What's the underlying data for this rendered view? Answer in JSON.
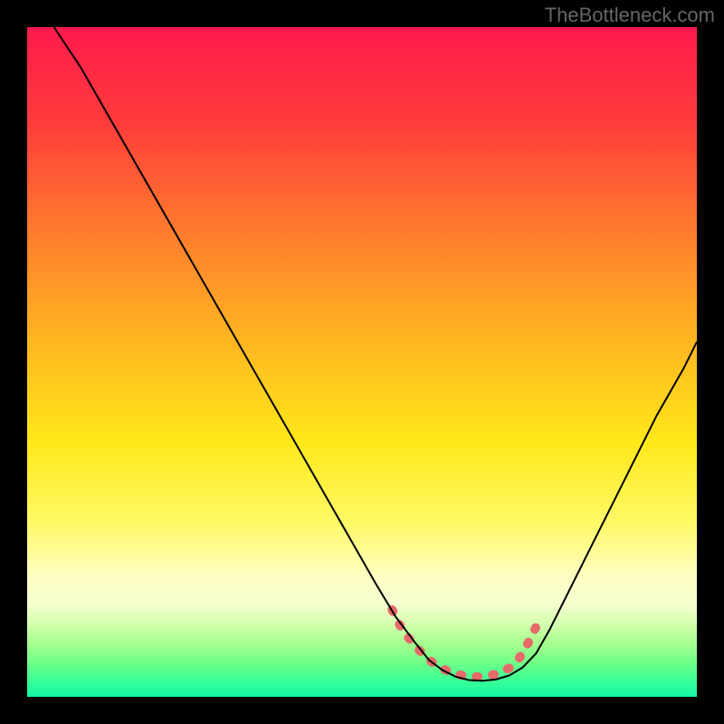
{
  "watermark": "TheBottleneck.com",
  "chart_data": {
    "type": "line",
    "title": "",
    "xlabel": "",
    "ylabel": "",
    "xlim": [
      0,
      100
    ],
    "ylim": [
      0,
      100
    ],
    "grid": false,
    "legend": false,
    "gradient_stops": [
      {
        "offset": 0,
        "color": "#ff1a4d"
      },
      {
        "offset": 14,
        "color": "#ff3b3b"
      },
      {
        "offset": 30,
        "color": "#ff7a2e"
      },
      {
        "offset": 46,
        "color": "#ffb321"
      },
      {
        "offset": 62,
        "color": "#ffe81a"
      },
      {
        "offset": 74,
        "color": "#fff966"
      },
      {
        "offset": 82,
        "color": "#ffffc2"
      },
      {
        "offset": 86,
        "color": "#f6ffd0"
      },
      {
        "offset": 89,
        "color": "#d7ffb0"
      },
      {
        "offset": 92,
        "color": "#a6ff8e"
      },
      {
        "offset": 95,
        "color": "#6dff87"
      },
      {
        "offset": 98,
        "color": "#32ff9a"
      },
      {
        "offset": 100,
        "color": "#14f5a6"
      }
    ],
    "series": [
      {
        "name": "bottleneck-curve",
        "stroke": "#000000",
        "x": [
          4,
          8,
          12,
          16,
          20,
          24,
          28,
          32,
          36,
          40,
          44,
          48,
          52,
          55,
          58,
          60,
          62,
          64,
          66,
          68,
          70,
          72,
          74,
          76,
          78,
          82,
          86,
          90,
          94,
          98,
          100
        ],
        "y": [
          100,
          94,
          87,
          80,
          73,
          66,
          59,
          52,
          45,
          38,
          31,
          24,
          17,
          12,
          8,
          5.5,
          4,
          3,
          2.5,
          2.4,
          2.6,
          3.2,
          4.4,
          6.5,
          10,
          18,
          26,
          34,
          42,
          49,
          53
        ]
      }
    ],
    "highlight_band": {
      "name": "optimal-range",
      "stroke": "#e66a6a",
      "stroke_width": 10,
      "x": [
        54.5,
        56,
        58,
        60,
        62,
        64,
        66,
        68,
        70,
        72,
        73.5,
        75,
        76.5
      ],
      "y": [
        13,
        10,
        7.5,
        5.5,
        4.2,
        3.4,
        3.0,
        3.0,
        3.4,
        4.3,
        5.8,
        8.4,
        11.5
      ]
    }
  }
}
